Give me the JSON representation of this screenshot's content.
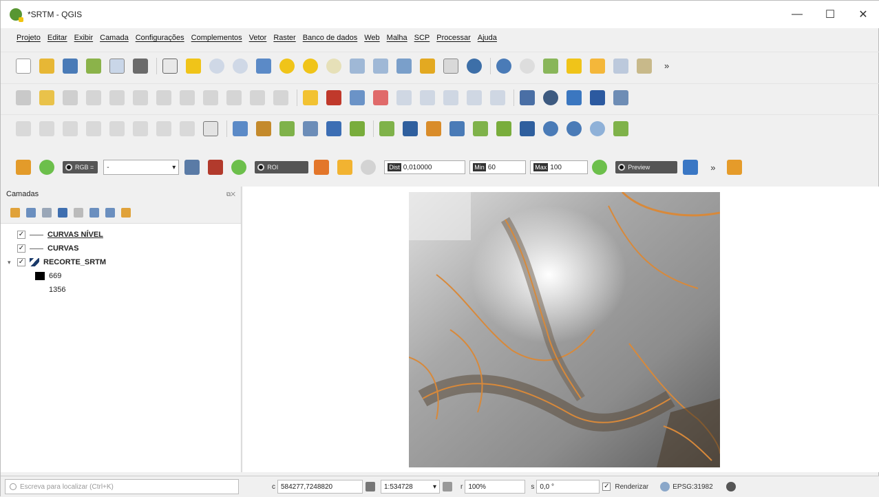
{
  "window": {
    "title": "*SRTM - QGIS",
    "minimize": "—",
    "maximize": "☐",
    "close": "✕"
  },
  "menu": [
    "Projeto",
    "Editar",
    "Exibir",
    "Camada",
    "Configurações",
    "Complementos",
    "Vetor",
    "Raster",
    "Banco de dados",
    "Web",
    "Malha",
    "SCP",
    "Processar",
    "Ajuda"
  ],
  "toolbar4": {
    "rgb_label": "RGB =",
    "band_value": "-",
    "roi_label": "ROI",
    "dist_tag": "Dist",
    "dist_value": "0,010000",
    "min_tag": "Min",
    "min_value": "60",
    "max_tag": "Max",
    "max_value": "100",
    "preview_label": "Preview"
  },
  "layers_panel": {
    "title": "Camadas",
    "layers": [
      {
        "name": "CURVAS NÍVEL",
        "checked": "✓",
        "type": "line"
      },
      {
        "name": "CURVAS",
        "checked": "✓",
        "type": "line"
      },
      {
        "name": "RECORTE_SRTM",
        "checked": "✓",
        "type": "raster"
      }
    ],
    "legend_min": "669",
    "legend_max": "1356"
  },
  "statusbar": {
    "locator_placeholder": "Escreva para localizar (Ctrl+K)",
    "coord_label": "c",
    "coord_value": "584277,7248820",
    "scale_label": "1:534728",
    "magnifier_label": "r",
    "magnifier_value": "100%",
    "rotation_label": "s",
    "rotation_value": "0,0 °",
    "render_check": "✓",
    "render_label": "Renderizar",
    "crs": "EPSG:31982"
  },
  "colors": {
    "accent_green": "#589632",
    "contour_orange": "#d8893a"
  }
}
